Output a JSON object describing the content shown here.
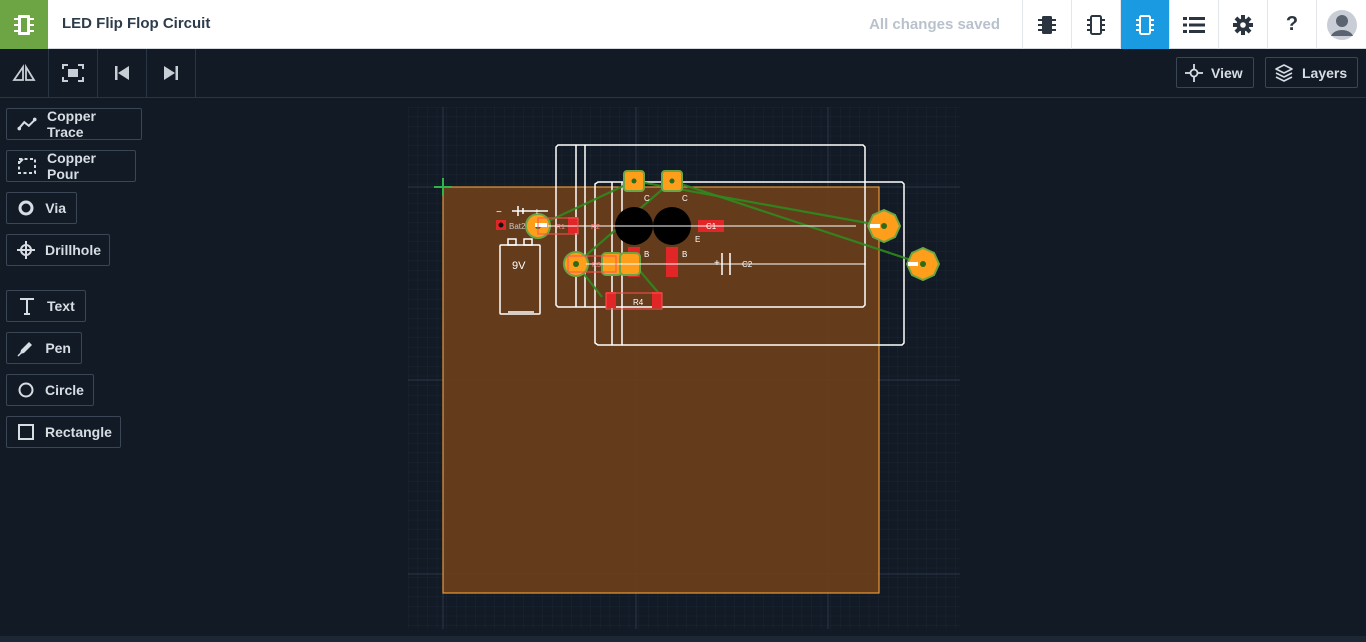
{
  "header": {
    "title": "LED Flip Flop Circuit",
    "save_status": "All changes saved",
    "help_label": "?"
  },
  "toolbar": {
    "view_label": "View",
    "layers_label": "Layers"
  },
  "tools": [
    {
      "label": "Copper Trace",
      "icon": "copper-trace-icon"
    },
    {
      "label": "Copper Pour",
      "icon": "copper-pour-icon"
    },
    {
      "label": "Via",
      "icon": "via-icon"
    },
    {
      "label": "Drillhole",
      "icon": "drillhole-icon"
    },
    {
      "label": "Text",
      "icon": "text-icon"
    },
    {
      "label": "Pen",
      "icon": "pen-icon"
    },
    {
      "label": "Circle",
      "icon": "circle-icon"
    },
    {
      "label": "Rectangle",
      "icon": "rectangle-icon"
    }
  ],
  "board": {
    "labels": {
      "bat": "Bat2",
      "battery": "9V",
      "c1": "C1",
      "c2": "C2",
      "r4": "R4",
      "r2": "R2",
      "r1": "R1",
      "r3": "R3",
      "pin_c": "C",
      "pin_b": "B",
      "pin_e": "E",
      "minus": "−",
      "plus": "+"
    }
  },
  "colors": {
    "brand_green": "#6da544",
    "active_blue": "#1a9ae0",
    "canvas_bg": "#111a25",
    "board_fill": "#6b3f1a",
    "pad_orange": "#ff9e1b",
    "trace_green": "#2e8a1f",
    "smd_red": "#e02626"
  }
}
